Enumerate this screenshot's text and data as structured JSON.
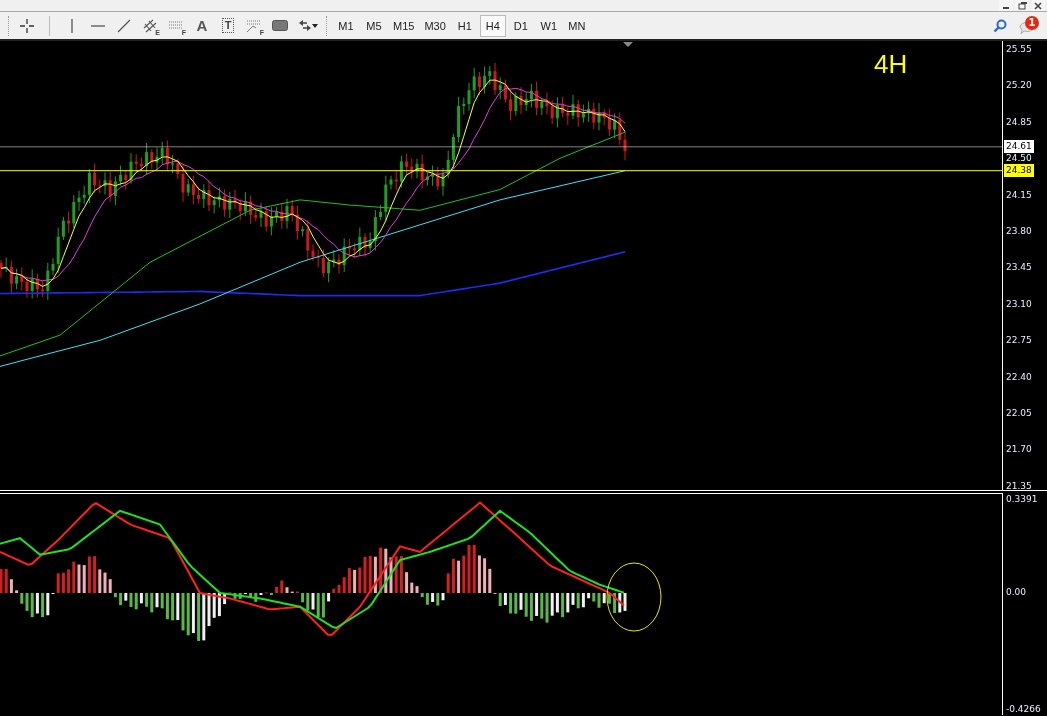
{
  "toolbar": {
    "tools": [
      {
        "kind": "crosshair"
      },
      {
        "kind": "separator"
      },
      {
        "kind": "vline"
      },
      {
        "kind": "hline"
      },
      {
        "kind": "trendline"
      },
      {
        "kind": "channel",
        "mark": "E"
      },
      {
        "kind": "fibo",
        "mark": "F"
      },
      {
        "kind": "text",
        "mark": "A"
      },
      {
        "kind": "label",
        "mark": "T"
      },
      {
        "kind": "fan",
        "mark": "F"
      },
      {
        "kind": "rectangle"
      },
      {
        "kind": "arrows"
      }
    ],
    "timeframes": [
      {
        "label": "M1",
        "selected": false
      },
      {
        "label": "M5",
        "selected": false
      },
      {
        "label": "M15",
        "selected": false
      },
      {
        "label": "M30",
        "selected": false
      },
      {
        "label": "H1",
        "selected": false
      },
      {
        "label": "H4",
        "selected": true
      },
      {
        "label": "D1",
        "selected": false
      },
      {
        "label": "W1",
        "selected": false
      },
      {
        "label": "MN",
        "selected": false
      }
    ],
    "notifications": {
      "count": "1"
    }
  },
  "chart": {
    "timeframe_label": "4H",
    "price_axis": [
      {
        "label": "25.55"
      },
      {
        "label": "25.20"
      },
      {
        "label": "24.85"
      },
      {
        "label": "24.50"
      },
      {
        "label": "24.15"
      },
      {
        "label": "23.80"
      },
      {
        "label": "23.45"
      },
      {
        "label": "23.10"
      },
      {
        "label": "22.75"
      },
      {
        "label": "22.40"
      },
      {
        "label": "22.05"
      },
      {
        "label": "21.70"
      },
      {
        "label": "21.35"
      }
    ],
    "price_markers": [
      {
        "label": "24.61",
        "color": "#ffffff"
      },
      {
        "label": "24.38",
        "color": "#ffff00"
      }
    ]
  },
  "oscillator": {
    "axis": [
      {
        "label": "0.3391"
      },
      {
        "label": "0.00"
      },
      {
        "label": "-0.4266"
      }
    ]
  }
}
